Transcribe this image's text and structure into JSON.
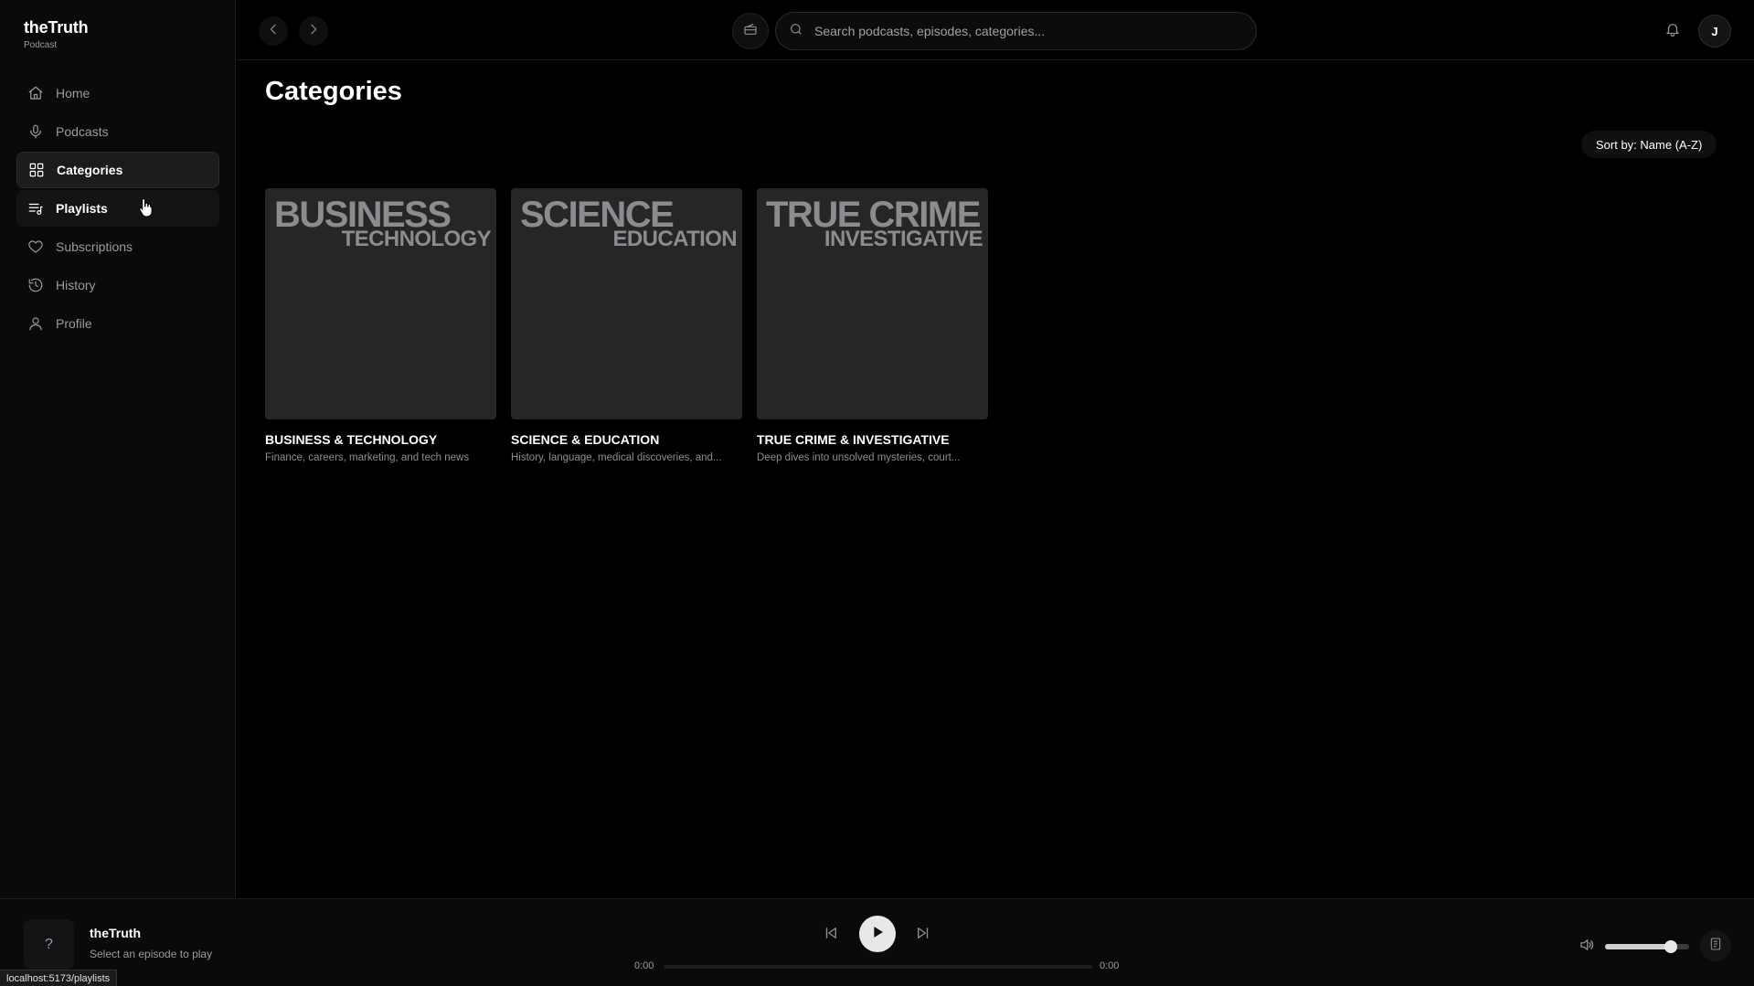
{
  "brand": {
    "title": "theTruth",
    "subtitle": "Podcast"
  },
  "sidebar": {
    "items": [
      {
        "label": "Home",
        "icon": "home-icon"
      },
      {
        "label": "Podcasts",
        "icon": "microphone-icon"
      },
      {
        "label": "Categories",
        "icon": "grid-icon",
        "state": "active"
      },
      {
        "label": "Playlists",
        "icon": "playlist-icon",
        "state": "hover"
      },
      {
        "label": "Subscriptions",
        "icon": "heart-icon"
      },
      {
        "label": "History",
        "icon": "history-icon"
      },
      {
        "label": "Profile",
        "icon": "user-icon"
      }
    ]
  },
  "topbar": {
    "search_placeholder": "Search podcasts, episodes, categories...",
    "avatar_initial": "J"
  },
  "main": {
    "title": "Categories",
    "sort_label": "Sort by: Name (A-Z)",
    "categories": [
      {
        "cover_line1": "BUSINESS",
        "cover_line2": "TECHNOLOGY",
        "title": "BUSINESS & TECHNOLOGY",
        "description": "Finance, careers, marketing, and tech news"
      },
      {
        "cover_line1": "SCIENCE",
        "cover_line2": "EDUCATION",
        "title": "SCIENCE & EDUCATION",
        "description": "History, language, medical discoveries, and..."
      },
      {
        "cover_line1": "TRUE CRIME",
        "cover_line2": "INVESTIGATIVE",
        "title": "TRUE CRIME & INVESTIGATIVE",
        "description": "Deep dives into unsolved mysteries, court..."
      }
    ]
  },
  "player": {
    "thumb_placeholder": "?",
    "title": "theTruth",
    "subtitle": "Select an episode to play",
    "time_current": "0:00",
    "time_total": "0:00",
    "progress": 0,
    "volume": 0.78
  },
  "status_url": "localhost:5173/playlists",
  "colors": {
    "background": "#000000",
    "sidebar": "#0a0a0a",
    "card_cover": "#262629",
    "muted_text": "#8e8e93"
  }
}
